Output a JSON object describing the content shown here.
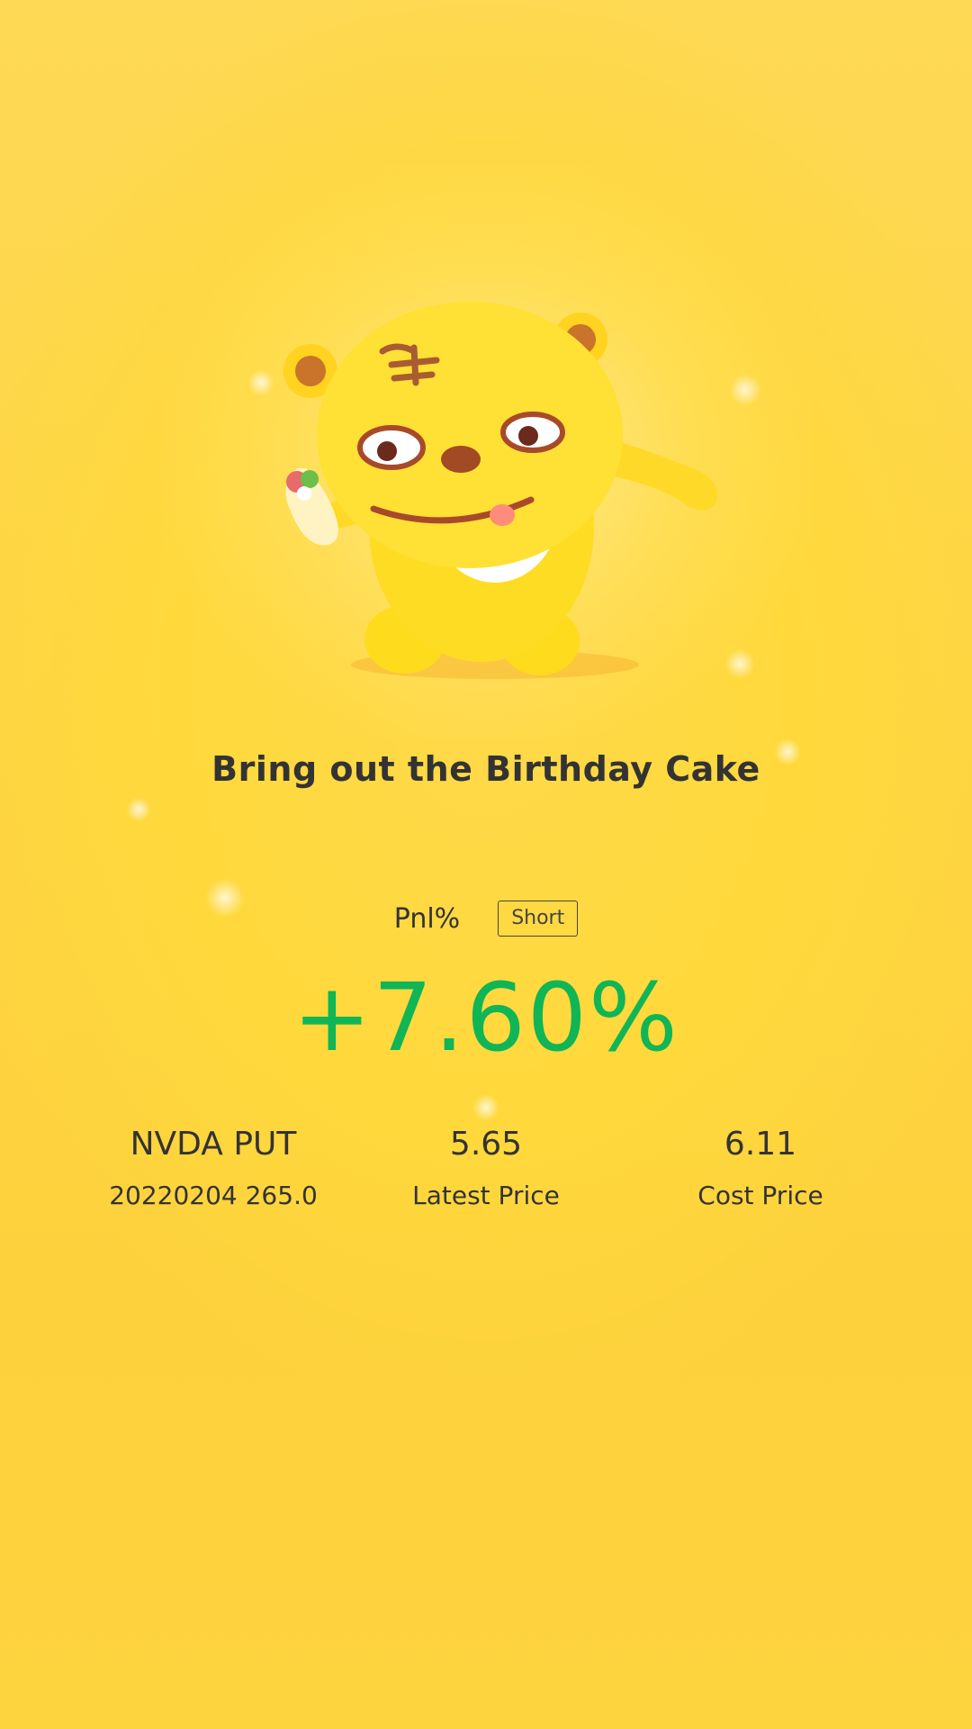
{
  "share_card": {
    "title": "Bring out the Birthday Cake",
    "pnl_label": "Pnl%",
    "direction": "Short",
    "pnl_value": "+7.60%",
    "contract": {
      "symbol": "NVDA PUT",
      "details": "20220204 265.0"
    },
    "latest_price": {
      "value": "5.65",
      "label": "Latest Price"
    },
    "cost_price": {
      "value": "6.11",
      "label": "Cost Price"
    }
  },
  "colors": {
    "background": "#fdd33e",
    "positive": "#10b556",
    "text": "#333333",
    "mascot": "#ffe034"
  },
  "icons": [
    "tiger-mascot-illustration"
  ]
}
